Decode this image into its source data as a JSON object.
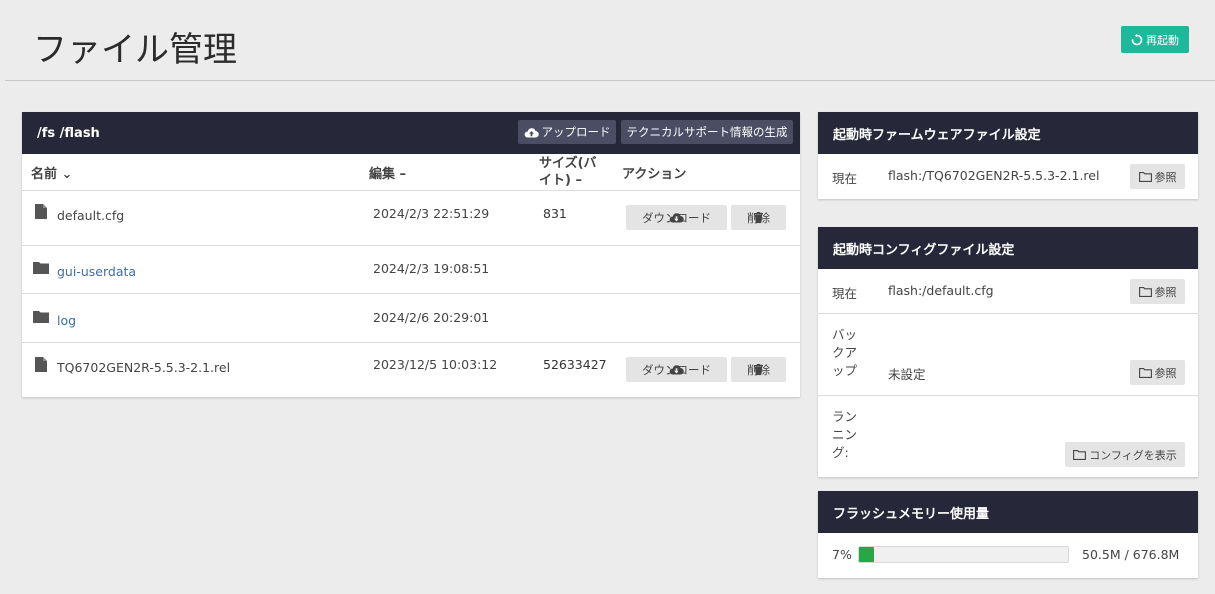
{
  "page": {
    "title": "ファイル管理",
    "restart_label": "再起動"
  },
  "files": {
    "path": "/fs /flash",
    "upload_label": "アップロード",
    "techsupport_label": "テクニカルサポート情報の生成",
    "columns": {
      "name": "名前",
      "edited": "編集",
      "size_line1": "サイズ(バ",
      "size_line2": "イト)",
      "action": "アクション"
    },
    "rows": [
      {
        "name": "default.cfg",
        "date": "2024/2/3 22:51:29",
        "size": "831",
        "type": "file"
      },
      {
        "name": "gui-userdata",
        "date": "2024/2/3 19:08:51",
        "size": "",
        "type": "folder"
      },
      {
        "name": "log",
        "date": "2024/2/6 20:29:01",
        "size": "",
        "type": "folder"
      },
      {
        "name": "TQ6702GEN2R-5.5.3-2.1.rel",
        "date": "2023/12/5 10:03:12",
        "size": "52633427",
        "type": "file"
      }
    ],
    "download_label": "ダウンロード",
    "delete_label": "削除"
  },
  "firmware": {
    "title": "起動時ファームウェアファイル設定",
    "current_label": "現在",
    "current_value": "flash:/TQ6702GEN2R-5.5.3-2.1.rel",
    "browse_label": "参照"
  },
  "config": {
    "title": "起動時コンフィグファイル設定",
    "current_label": "現在",
    "current_value": "flash:/default.cfg",
    "browse_label": "参照",
    "backup_label_l1": "バッ",
    "backup_label_l2": "クア",
    "backup_label_l3": "ップ",
    "backup_value": "未設定",
    "backup_browse_label": "参照",
    "running_label_l1": "ラン",
    "running_label_l2": "ニン",
    "running_label_l3": "グ:",
    "show_config_label": "コンフィグを表示"
  },
  "memory": {
    "title": "フラッシュメモリー使用量",
    "percent_label": "7%",
    "usage_fraction": 0.07,
    "usage_text": "50.5M / 676.8M",
    "bar_color": "#28a745"
  },
  "colors": {
    "header_bg": "#262839",
    "accent": "#1fb89a",
    "link": "#3a6fa8"
  }
}
